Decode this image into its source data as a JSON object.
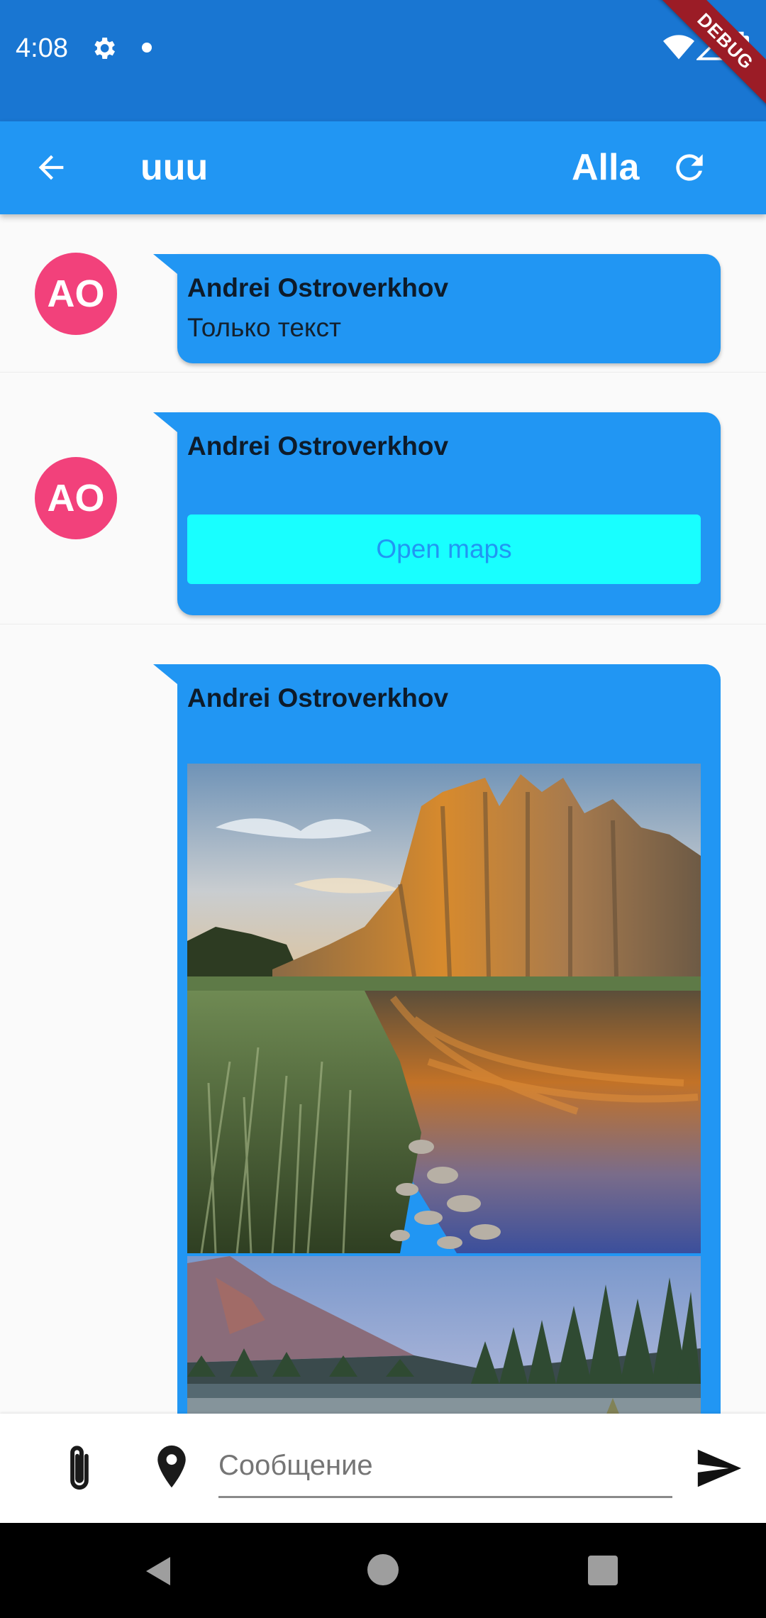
{
  "status_bar": {
    "time": "4:08",
    "debug_label": "DEBUG",
    "icons": [
      "gear-icon",
      "notification-dot-icon",
      "wifi-icon",
      "signal-icon",
      "battery-icon"
    ]
  },
  "app_bar": {
    "title": "uuu",
    "user": "Alla",
    "icons": [
      "arrow-back-icon",
      "refresh-icon"
    ]
  },
  "messages": [
    {
      "avatar": "AO",
      "sender": "Andrei Ostroverkhov",
      "text": "Только текст"
    },
    {
      "avatar": "AO",
      "sender": "Andrei Ostroverkhov",
      "button_label": "Open maps"
    },
    {
      "sender": "Andrei Ostroverkhov",
      "images": [
        "river-cliffs-photo",
        "mountain-forest-photo"
      ]
    }
  ],
  "input_bar": {
    "placeholder": "Сообщение",
    "value": "",
    "icons": [
      "attach-icon",
      "location-pin-icon",
      "send-icon"
    ]
  },
  "colors": {
    "status_bar": "#1976d2",
    "app_bar": "#2196f3",
    "bubble": "#2196f3",
    "avatar": "#f2417b",
    "maps_button": "#18ffff",
    "debug_ribbon": "#9b1c26"
  }
}
